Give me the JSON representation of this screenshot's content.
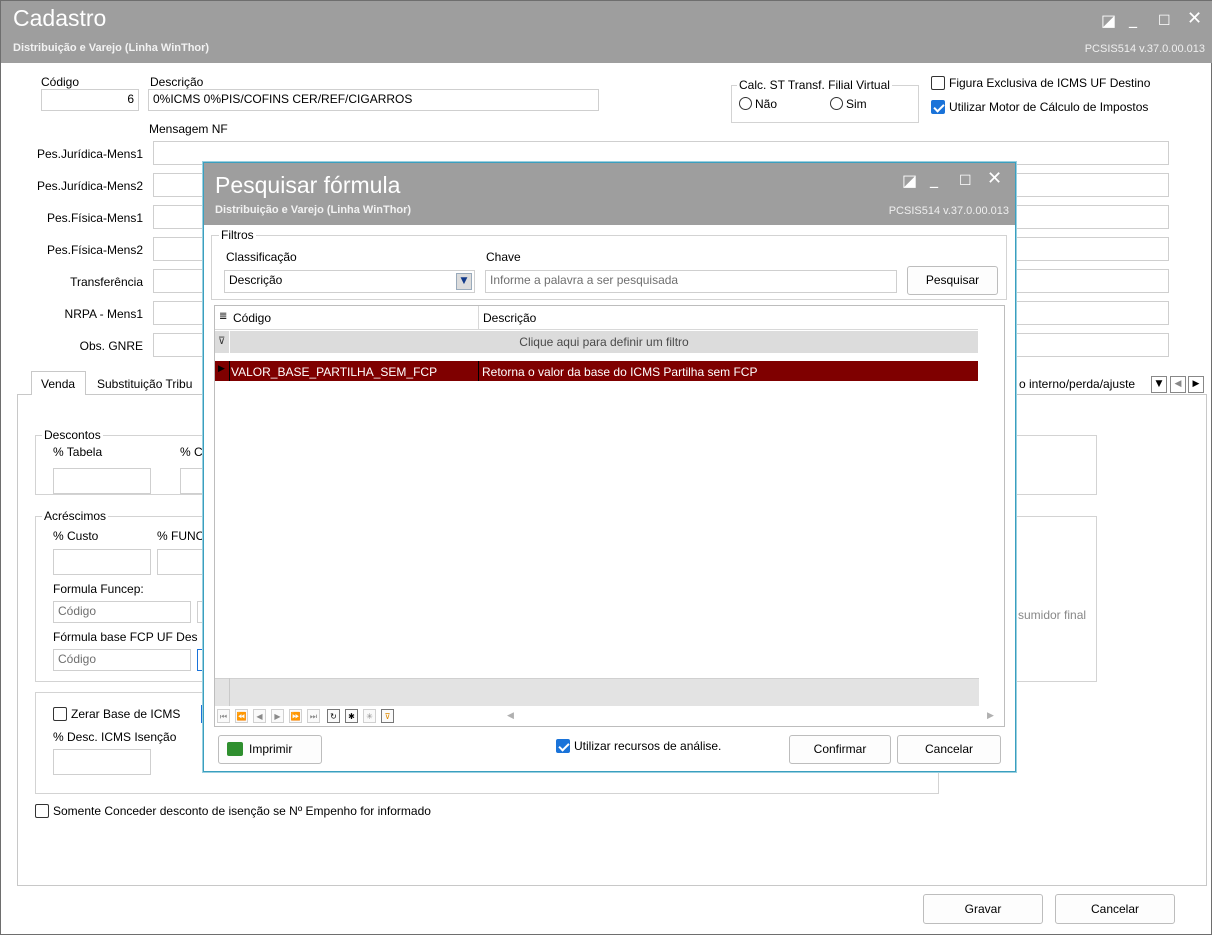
{
  "main_window": {
    "title": "Cadastro",
    "subtitle": "Distribuição e Varejo (Linha WinThor)",
    "version": "PCSIS514  v.37.0.00.013",
    "codigo_label": "Código",
    "codigo_value": "6",
    "descricao_label": "Descrição",
    "descricao_value": "0%ICMS 0%PIS/COFINS  CER/REF/CIGARROS",
    "calc_st_label": "Calc. ST Transf. Filial Virtual",
    "radio_nao": "Não",
    "radio_sim": "Sim",
    "figura_exclusiva_label": "Figura Exclusiva de ICMS UF Destino",
    "figura_exclusiva_checked": false,
    "motor_calculo_label": "Utilizar Motor de Cálculo de Impostos",
    "motor_calculo_checked": true,
    "mensagem_nf_label": "Mensagem NF",
    "mensagem_fields": [
      {
        "label": "Pes.Jurídica-Mens1",
        "value": ""
      },
      {
        "label": "Pes.Jurídica-Mens2",
        "value": ""
      },
      {
        "label": "Pes.Física-Mens1",
        "value": ""
      },
      {
        "label": "Pes.Física-Mens2",
        "value": ""
      },
      {
        "label": "Transferência",
        "value": ""
      },
      {
        "label": "NRPA - Mens1",
        "value": ""
      },
      {
        "label": "Obs. GNRE",
        "value": ""
      }
    ],
    "tabs": [
      "Venda",
      "Substituição Tribu",
      "o interno/perda/ajuste"
    ],
    "descontos_label": "Descontos",
    "pct_tabela_label": "% Tabela",
    "pct_c_label": "% C",
    "acrescimos_label": "Acréscimos",
    "pct_custo_label": "% Custo",
    "pct_func_label": "% FUNC",
    "formula_funcep_label": "Formula Funcep:",
    "formula_funcep_placeholder": "Código",
    "formula_fcp_label": "Fórmula base FCP UF Des",
    "formula_fcp_placeholder": "Código",
    "consumidor_final_text": "sumidor final",
    "zerar_base_label": "Zerar Base de ICMS",
    "pct_desc_icms_label": "% Desc. ICMS Isenção",
    "somente_conceder_label": "Somente Conceder desconto de isenção se Nº Empenho for informado",
    "gravar_label": "Gravar",
    "cancelar_label": "Cancelar"
  },
  "dialog": {
    "title": "Pesquisar fórmula",
    "subtitle": "Distribuição e Varejo (Linha WinThor)",
    "version": "PCSIS514  v.37.0.00.013",
    "filtros_label": "Filtros",
    "classificacao_label": "Classificação",
    "classificacao_value": "Descrição",
    "chave_label": "Chave",
    "chave_placeholder": "Informe a palavra a ser pesquisada",
    "pesquisar_label": "Pesquisar",
    "grid": {
      "columns": [
        "Código",
        "Descrição"
      ],
      "filter_hint": "Clique aqui para definir um filtro",
      "rows": [
        {
          "codigo": "VALOR_BASE_PARTILHA_SEM_FCP",
          "descricao": "Retorna o valor da base do ICMS Partilha sem FCP"
        }
      ]
    },
    "imprimir_label": "Imprimir",
    "recursos_analise_label": "Utilizar recursos de análise.",
    "recursos_analise_checked": true,
    "confirmar_label": "Confirmar",
    "cancelar_label": "Cancelar"
  },
  "colors": {
    "titlebar": "#9e9e9e",
    "selected_row": "#7f0000",
    "checkbox_accent": "#1a73d9"
  }
}
